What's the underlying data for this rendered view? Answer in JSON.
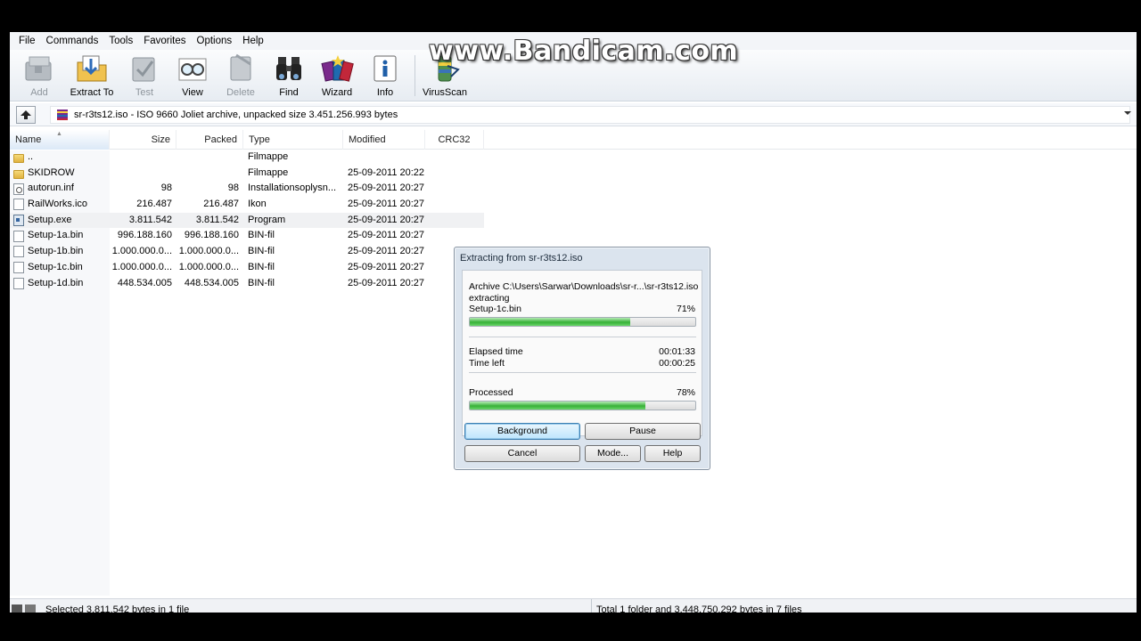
{
  "watermark": "www.Bandicam.com",
  "menu": [
    "File",
    "Commands",
    "Tools",
    "Favorites",
    "Options",
    "Help"
  ],
  "toolbar": {
    "add": "Add",
    "extract_to": "Extract To",
    "test": "Test",
    "view": "View",
    "delete": "Delete",
    "find": "Find",
    "wizard": "Wizard",
    "info": "Info",
    "virusscan": "VirusScan"
  },
  "address": {
    "text": "sr-r3ts12.iso - ISO 9660 Joliet archive, unpacked size 3.451.256.993 bytes"
  },
  "columns": {
    "name": "Name",
    "size": "Size",
    "packed": "Packed",
    "type": "Type",
    "modified": "Modified",
    "crc32": "CRC32"
  },
  "files": [
    {
      "name": "..",
      "size": "",
      "packed": "",
      "type": "Filmappe",
      "modified": "",
      "icon": "folder-icon"
    },
    {
      "name": "SKIDROW",
      "size": "",
      "packed": "",
      "type": "Filmappe",
      "modified": "25-09-2011 20:22",
      "icon": "folder-icon"
    },
    {
      "name": "autorun.inf",
      "size": "98",
      "packed": "98",
      "type": "Installationsoplysn...",
      "modified": "25-09-2011 20:27",
      "icon": "settings-file-icon"
    },
    {
      "name": "RailWorks.ico",
      "size": "216.487",
      "packed": "216.487",
      "type": "Ikon",
      "modified": "25-09-2011 20:27",
      "icon": "file-icon"
    },
    {
      "name": "Setup.exe",
      "size": "3.811.542",
      "packed": "3.811.542",
      "type": "Program",
      "modified": "25-09-2011 20:27",
      "icon": "executable-icon"
    },
    {
      "name": "Setup-1a.bin",
      "size": "996.188.160",
      "packed": "996.188.160",
      "type": "BIN-fil",
      "modified": "25-09-2011 20:27",
      "icon": "file-icon"
    },
    {
      "name": "Setup-1b.bin",
      "size": "1.000.000.0...",
      "packed": "1.000.000.0...",
      "type": "BIN-fil",
      "modified": "25-09-2011 20:27",
      "icon": "file-icon"
    },
    {
      "name": "Setup-1c.bin",
      "size": "1.000.000.0...",
      "packed": "1.000.000.0...",
      "type": "BIN-fil",
      "modified": "25-09-2011 20:27",
      "icon": "file-icon"
    },
    {
      "name": "Setup-1d.bin",
      "size": "448.534.005",
      "packed": "448.534.005",
      "type": "BIN-fil",
      "modified": "25-09-2011 20:27",
      "icon": "file-icon"
    }
  ],
  "selected_row_index": 4,
  "status": {
    "left": "Selected 3.811.542 bytes in 1 file",
    "right": "Total 1 folder and 3.448.750.292 bytes in 7 files"
  },
  "dialog": {
    "title": "Extracting from sr-r3ts12.iso",
    "archive_line": "Archive C:\\Users\\Sarwar\\Downloads\\sr-r...\\sr-r3ts12.iso",
    "action": "extracting",
    "current_file": "Setup-1c.bin",
    "file_percent_label": "71%",
    "file_progress": 0.71,
    "elapsed_label": "Elapsed time",
    "elapsed_value": "00:01:33",
    "timeleft_label": "Time left",
    "timeleft_value": "00:00:25",
    "processed_label": "Processed",
    "processed_percent_label": "78%",
    "processed_progress": 0.78,
    "buttons": {
      "background": "Background",
      "pause": "Pause",
      "cancel": "Cancel",
      "mode": "Mode...",
      "help": "Help"
    }
  },
  "colors": {
    "progress_green": "#37b137",
    "selection": "#f0f1f3"
  }
}
